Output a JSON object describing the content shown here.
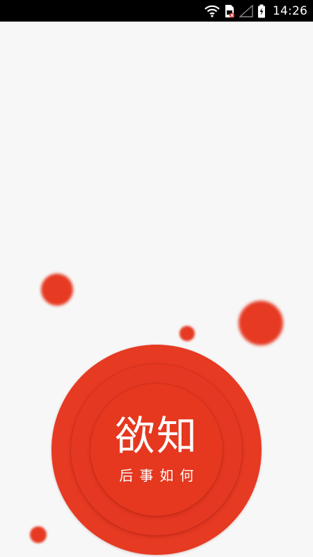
{
  "status_bar": {
    "time": "14:26",
    "icons": [
      "wifi-icon",
      "sim-card-icon",
      "signal-icon",
      "battery-charging-icon"
    ]
  },
  "splash": {
    "logo_title": "欲知",
    "logo_subtitle": "后事如何"
  },
  "colors": {
    "brand_red": "#e63a23",
    "background": "#f7f7f7",
    "status_bar": "#000000",
    "text_on_brand": "#ffffff"
  }
}
